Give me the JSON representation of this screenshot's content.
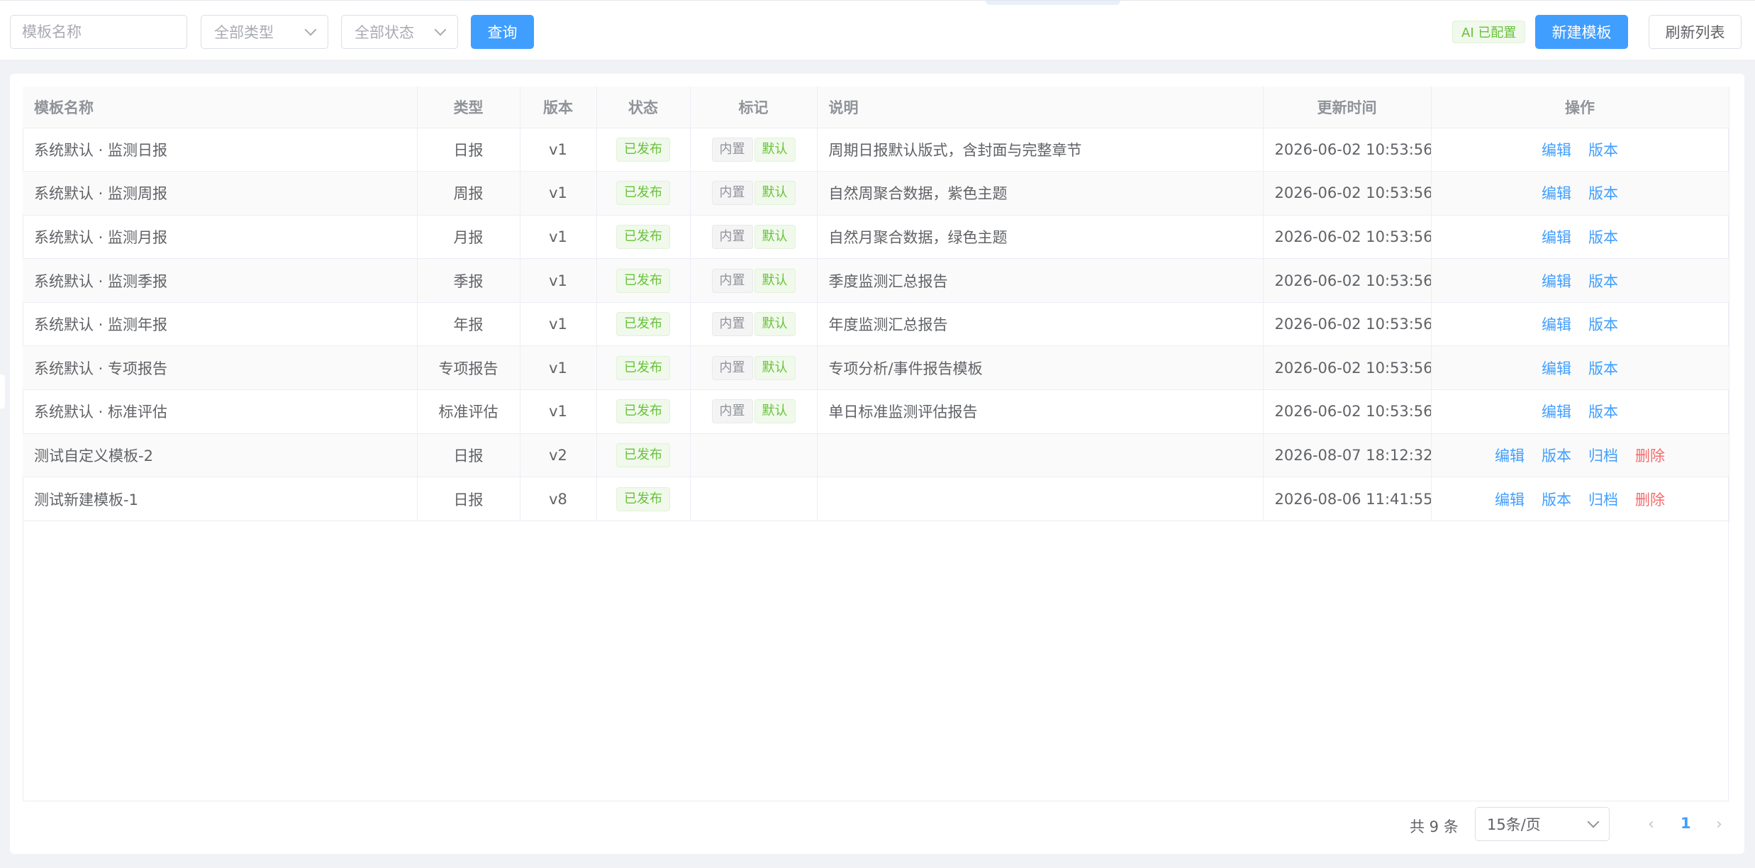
{
  "toolbar": {
    "name_placeholder": "模板名称",
    "type_select": "全部类型",
    "status_select": "全部状态",
    "query_button": "查询",
    "ai_badge": "AI 已配置",
    "new_button": "新建模板",
    "refresh_button": "刷新列表"
  },
  "table": {
    "headers": [
      "模板名称",
      "类型",
      "版本",
      "状态",
      "标记",
      "说明",
      "更新时间",
      "操作"
    ],
    "rows": [
      {
        "name": "系统默认 · 监测日报",
        "type": "日报",
        "version": "v1",
        "status": "已发布",
        "builtin": "内置",
        "default": "默认",
        "desc": "周期日报默认版式，含封面与完整章节",
        "updated": "2026-06-02 10:53:56",
        "actions": [
          "编辑",
          "版本"
        ]
      },
      {
        "name": "系统默认 · 监测周报",
        "type": "周报",
        "version": "v1",
        "status": "已发布",
        "builtin": "内置",
        "default": "默认",
        "desc": "自然周聚合数据，紫色主题",
        "updated": "2026-06-02 10:53:56",
        "actions": [
          "编辑",
          "版本"
        ]
      },
      {
        "name": "系统默认 · 监测月报",
        "type": "月报",
        "version": "v1",
        "status": "已发布",
        "builtin": "内置",
        "default": "默认",
        "desc": "自然月聚合数据，绿色主题",
        "updated": "2026-06-02 10:53:56",
        "actions": [
          "编辑",
          "版本"
        ]
      },
      {
        "name": "系统默认 · 监测季报",
        "type": "季报",
        "version": "v1",
        "status": "已发布",
        "builtin": "内置",
        "default": "默认",
        "desc": "季度监测汇总报告",
        "updated": "2026-06-02 10:53:56",
        "actions": [
          "编辑",
          "版本"
        ]
      },
      {
        "name": "系统默认 · 监测年报",
        "type": "年报",
        "version": "v1",
        "status": "已发布",
        "builtin": "内置",
        "default": "默认",
        "desc": "年度监测汇总报告",
        "updated": "2026-06-02 10:53:56",
        "actions": [
          "编辑",
          "版本"
        ]
      },
      {
        "name": "系统默认 · 专项报告",
        "type": "专项报告",
        "version": "v1",
        "status": "已发布",
        "builtin": "内置",
        "default": "默认",
        "desc": "专项分析/事件报告模板",
        "updated": "2026-06-02 10:53:56",
        "actions": [
          "编辑",
          "版本"
        ]
      },
      {
        "name": "系统默认 · 标准评估",
        "type": "标准评估",
        "version": "v1",
        "status": "已发布",
        "builtin": "内置",
        "default": "默认",
        "desc": "单日标准监测评估报告",
        "updated": "2026-06-02 10:53:56",
        "actions": [
          "编辑",
          "版本"
        ]
      },
      {
        "name": "测试自定义模板-2",
        "type": "日报",
        "version": "v2",
        "status": "已发布",
        "builtin": "",
        "default": "",
        "desc": "",
        "updated": "2026-08-07 18:12:32",
        "actions": [
          "编辑",
          "版本",
          "归档",
          "删除"
        ]
      },
      {
        "name": "测试新建模板-1",
        "type": "日报",
        "version": "v8",
        "status": "已发布",
        "builtin": "",
        "default": "",
        "desc": "",
        "updated": "2026-08-06 11:41:55",
        "actions": [
          "编辑",
          "版本",
          "归档",
          "删除"
        ]
      }
    ]
  },
  "pagination": {
    "total": "共 9 条",
    "page_size": "15条/页",
    "current_page": "1"
  }
}
